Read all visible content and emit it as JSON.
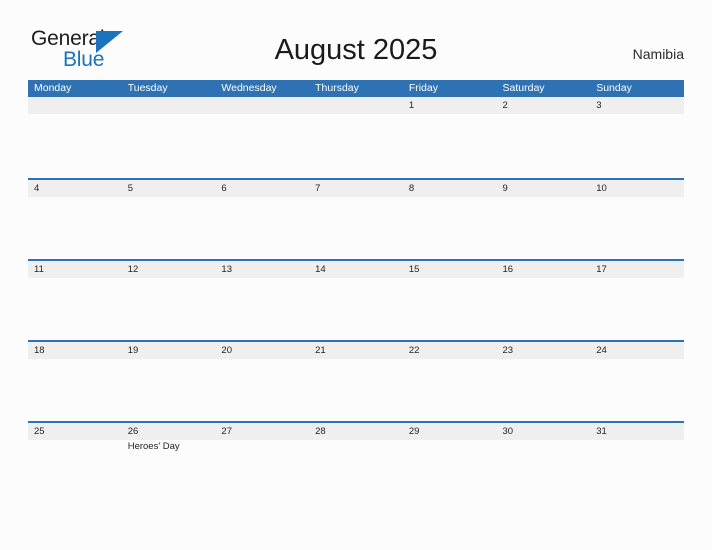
{
  "brand": {
    "name_part1": "General",
    "name_part2": "Blue",
    "triangle_color": "#1b72bd",
    "text_color": "#1d1d1d"
  },
  "header": {
    "title": "August 2025",
    "country": "Namibia"
  },
  "theme": {
    "header_blue": "#2f72b4",
    "date_band_gray": "#efefef",
    "page_background": "#fcfcfc",
    "text_color": "#232323"
  },
  "calendar": {
    "day_names": [
      "Monday",
      "Tuesday",
      "Wednesday",
      "Thursday",
      "Friday",
      "Saturday",
      "Sunday"
    ],
    "weeks": [
      {
        "days": [
          {
            "num": "",
            "events": []
          },
          {
            "num": "",
            "events": []
          },
          {
            "num": "",
            "events": []
          },
          {
            "num": "",
            "events": []
          },
          {
            "num": "1",
            "events": []
          },
          {
            "num": "2",
            "events": []
          },
          {
            "num": "3",
            "events": []
          }
        ]
      },
      {
        "days": [
          {
            "num": "4",
            "events": []
          },
          {
            "num": "5",
            "events": []
          },
          {
            "num": "6",
            "events": []
          },
          {
            "num": "7",
            "events": []
          },
          {
            "num": "8",
            "events": []
          },
          {
            "num": "9",
            "events": []
          },
          {
            "num": "10",
            "events": []
          }
        ]
      },
      {
        "days": [
          {
            "num": "11",
            "events": []
          },
          {
            "num": "12",
            "events": []
          },
          {
            "num": "13",
            "events": []
          },
          {
            "num": "14",
            "events": []
          },
          {
            "num": "15",
            "events": []
          },
          {
            "num": "16",
            "events": []
          },
          {
            "num": "17",
            "events": []
          }
        ]
      },
      {
        "days": [
          {
            "num": "18",
            "events": []
          },
          {
            "num": "19",
            "events": []
          },
          {
            "num": "20",
            "events": []
          },
          {
            "num": "21",
            "events": []
          },
          {
            "num": "22",
            "events": []
          },
          {
            "num": "23",
            "events": []
          },
          {
            "num": "24",
            "events": []
          }
        ]
      },
      {
        "days": [
          {
            "num": "25",
            "events": []
          },
          {
            "num": "26",
            "events": [
              "Heroes' Day"
            ]
          },
          {
            "num": "27",
            "events": []
          },
          {
            "num": "28",
            "events": []
          },
          {
            "num": "29",
            "events": []
          },
          {
            "num": "30",
            "events": []
          },
          {
            "num": "31",
            "events": []
          }
        ]
      }
    ]
  }
}
